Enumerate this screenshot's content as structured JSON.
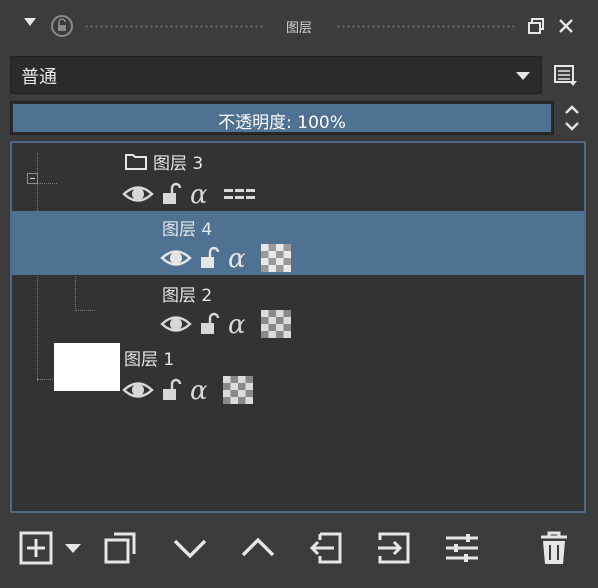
{
  "panel": {
    "title": "图层",
    "blend_mode": "普通",
    "opacity_label": "不透明度: 100%",
    "opacity": 1.0
  },
  "layers": [
    {
      "name": "图层 3",
      "type": "group",
      "expanded": true,
      "selected": false,
      "visible": true,
      "locked": false,
      "alpha_locked": false
    },
    {
      "name": "图层 4",
      "type": "paint",
      "selected": true,
      "visible": true,
      "locked": false,
      "alpha_locked": false
    },
    {
      "name": "图层 2",
      "type": "paint",
      "selected": false,
      "visible": true,
      "locked": false,
      "alpha_locked": false
    },
    {
      "name": "图层 1",
      "type": "paint",
      "selected": false,
      "visible": true,
      "locked": false,
      "alpha_locked": false
    }
  ],
  "toolbar": {
    "buttons": [
      "add-layer",
      "add-layer-menu",
      "duplicate-layer",
      "move-layer-down",
      "move-layer-up",
      "move-into-previous-group",
      "move-out-of-group",
      "layer-properties",
      "delete-layer"
    ]
  },
  "colors": {
    "selection": "#4f7192",
    "panel_bg": "#3c3c3c",
    "tree_bg": "#333333",
    "tree_border": "#4f6a86"
  }
}
